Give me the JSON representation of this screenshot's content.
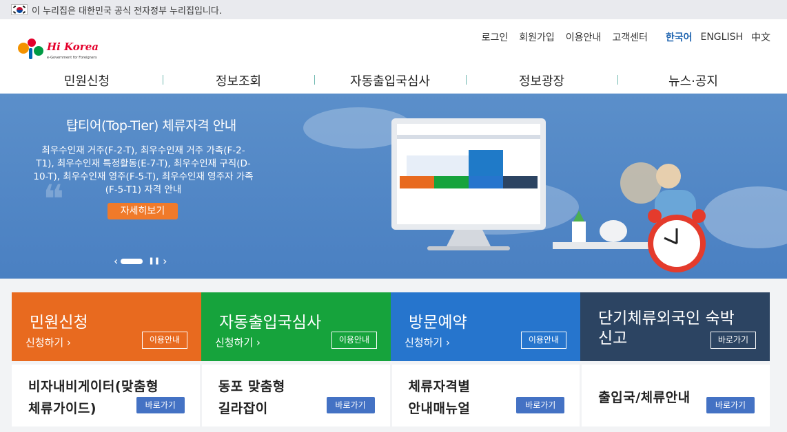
{
  "gov_bar": {
    "text": "이 누리집은 대한민국 공식 전자정부 누리집입니다."
  },
  "logo": {
    "text": "Hi Korea",
    "tagline": "e-Government for Foreigners"
  },
  "util_nav": {
    "links": [
      "로그인",
      "회원가입",
      "이용안내",
      "고객센터"
    ],
    "languages": [
      "한국어",
      "ENGLISH",
      "中文"
    ],
    "active_language": "한국어"
  },
  "gnb": [
    "민원신청",
    "정보조회",
    "자동출입국심사",
    "정보광장",
    "뉴스·공지"
  ],
  "banner": {
    "title": "탑티어(Top-Tier) 체류자격 안내",
    "description": "최우수인재 거주(F-2-T), 최우수인재 거주 가족(F-2-T1), 최우수인재 특정활동(E-7-T), 최우수인재 구직(D-10-T), 최우수인재 영주(F-5-T), 최우수인재 영주자 가족(F-5-T1) 자격 안내",
    "button": "자세히보기"
  },
  "service_cards": [
    {
      "name": "민원신청",
      "sub": "신청하기",
      "guide": "이용안내",
      "color": "#e86a1f"
    },
    {
      "name": "자동출입국심사",
      "sub": "신청하기",
      "guide": "이용안내",
      "color": "#16a33c"
    },
    {
      "name": "방문예약",
      "sub": "신청하기",
      "guide": "이용안내",
      "color": "#2675cd"
    },
    {
      "name_line1": "단기체류외국인 숙박",
      "name_line2": "신고",
      "guide": "바로가기",
      "color": "#2c4462"
    }
  ],
  "info_cards": [
    {
      "line1": "비자내비게이터(맞춤형",
      "line2": "체류가이드)",
      "button": "바로가기"
    },
    {
      "line1": "동포 맞춤형",
      "line2": "길라잡이",
      "button": "바로가기"
    },
    {
      "line1": "체류자격별",
      "line2": "안내매뉴얼",
      "button": "바로가기"
    },
    {
      "line1": "출입국/체류안내",
      "button": "바로가기"
    }
  ]
}
